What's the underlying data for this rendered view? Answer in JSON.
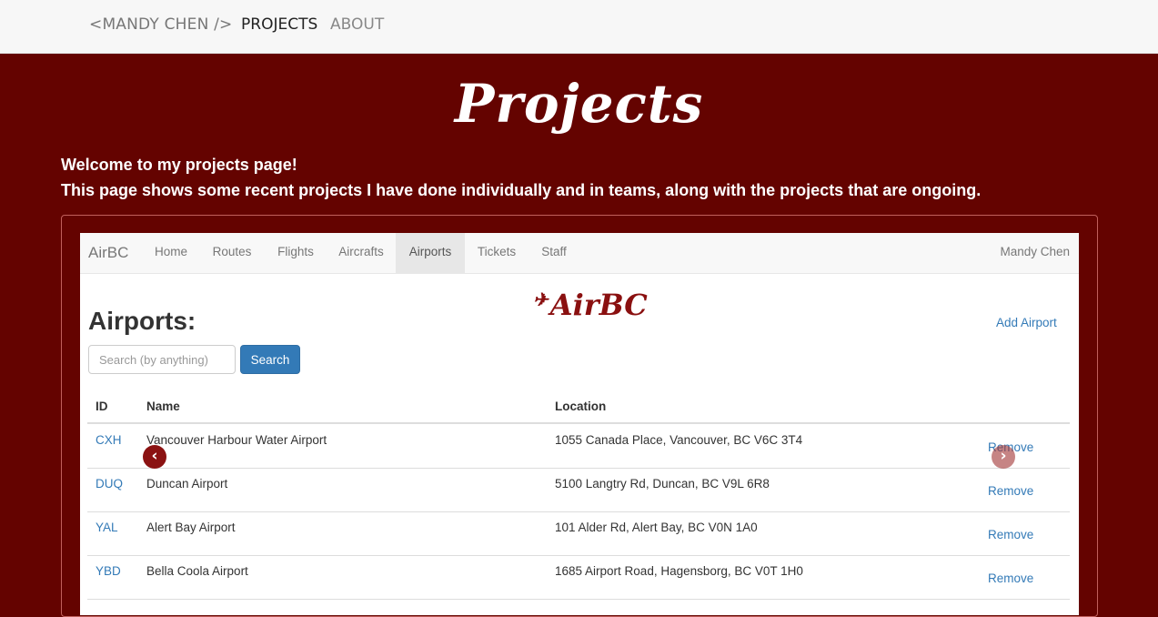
{
  "site_nav": {
    "brand": "<MANDY CHEN />",
    "links": [
      "PROJECTS",
      "ABOUT"
    ]
  },
  "page": {
    "title": "Projects",
    "intro_line1": "Welcome to my projects page!",
    "intro_line2": "This page shows some recent projects I have done individually and in teams, along with the projects that are ongoing."
  },
  "project_shot": {
    "nav": {
      "brand": "AirBC",
      "tabs": [
        "Home",
        "Routes",
        "Flights",
        "Aircrafts",
        "Airports",
        "Tickets",
        "Staff"
      ],
      "active_tab": "Airports",
      "user": "Mandy Chen"
    },
    "logo_text": "AirBC",
    "heading": "Airports:",
    "add_link": "Add Airport",
    "search": {
      "placeholder": "Search (by anything)",
      "button": "Search"
    },
    "table": {
      "columns": [
        "ID",
        "Name",
        "Location"
      ],
      "rows": [
        {
          "id": "CXH",
          "name": "Vancouver Harbour Water Airport",
          "location": "1055 Canada Place, Vancouver, BC V6C 3T4",
          "action": "Remove"
        },
        {
          "id": "DUQ",
          "name": "Duncan Airport",
          "location": "5100 Langtry Rd, Duncan, BC V9L 6R8",
          "action": "Remove"
        },
        {
          "id": "YAL",
          "name": "Alert Bay Airport",
          "location": "101 Alder Rd, Alert Bay, BC V0N 1A0",
          "action": "Remove"
        },
        {
          "id": "YBD",
          "name": "Bella Coola Airport",
          "location": "1685 Airport Road, Hagensborg, BC V0T 1H0",
          "action": "Remove"
        }
      ]
    }
  },
  "colors": {
    "background": "#640300",
    "link": "#337ab7"
  }
}
